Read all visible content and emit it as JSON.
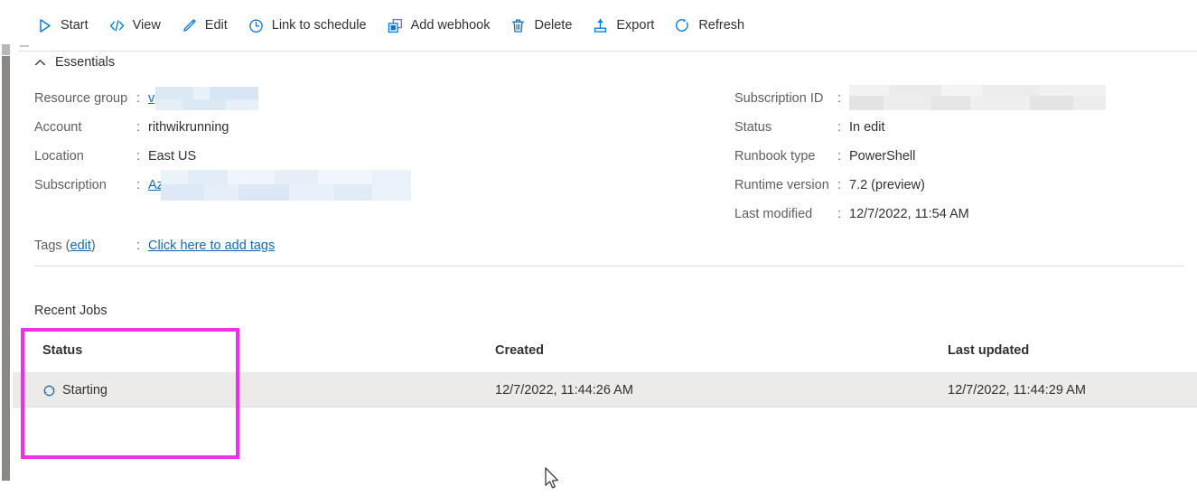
{
  "toolbar": {
    "items": [
      {
        "label": "Start",
        "icon": "play-icon"
      },
      {
        "label": "View",
        "icon": "code-icon"
      },
      {
        "label": "Edit",
        "icon": "pencil-icon"
      },
      {
        "label": "Link to schedule",
        "icon": "clock-icon"
      },
      {
        "label": "Add webhook",
        "icon": "webhook-squares-icon"
      },
      {
        "label": "Delete",
        "icon": "trash-icon"
      },
      {
        "label": "Export",
        "icon": "export-upload-icon"
      },
      {
        "label": "Refresh",
        "icon": "refresh-circle-icon"
      }
    ]
  },
  "essentials": {
    "title": "Essentials",
    "collapse_icon": "chevron-up-icon",
    "left": [
      {
        "key": "Resource group",
        "colon": ":",
        "value": "v",
        "link": true,
        "redacted": true
      },
      {
        "key": "Account",
        "colon": ":",
        "value": "rithwikrunning",
        "link": false,
        "redacted": false
      },
      {
        "key": "Location",
        "colon": ":",
        "value": "East US",
        "link": false,
        "redacted": false
      },
      {
        "key": "Subscription",
        "colon": ":",
        "value": "Az",
        "link": true,
        "redacted": true
      }
    ],
    "right": [
      {
        "key": "Subscription ID",
        "colon": ":",
        "value": "",
        "redacted": true
      },
      {
        "key": "Status",
        "colon": ":",
        "value": "In edit",
        "redacted": false
      },
      {
        "key": "Runbook type",
        "colon": ":",
        "value": "PowerShell",
        "redacted": false
      },
      {
        "key": "Runtime version",
        "colon": ":",
        "value": "7.2 (preview)",
        "redacted": false
      },
      {
        "key": "Last modified",
        "colon": ":",
        "value": "12/7/2022, 11:54 AM",
        "redacted": false
      }
    ],
    "tags": {
      "label": "Tags (",
      "edit_label": "edit",
      "label_end": ")",
      "colon": ":",
      "value_link": "Click here to add tags"
    }
  },
  "recent_jobs": {
    "title": "Recent Jobs",
    "columns": [
      "Status",
      "Created",
      "Last updated"
    ],
    "rows": [
      {
        "status": "Starting",
        "status_icon": "refresh-spinner-icon",
        "created": "12/7/2022, 11:44:26 AM",
        "last_updated": "12/7/2022, 11:44:29 AM"
      }
    ]
  },
  "annotation": {
    "highlight_color": "#ee30ee",
    "target": "status-column"
  },
  "colors": {
    "accent": "#0f6cbd",
    "icon_blue": "#0078d4",
    "row_selected": "#edebe9",
    "divider": "#e1dfdd",
    "text": "#323130",
    "text_secondary": "#605e5c"
  }
}
